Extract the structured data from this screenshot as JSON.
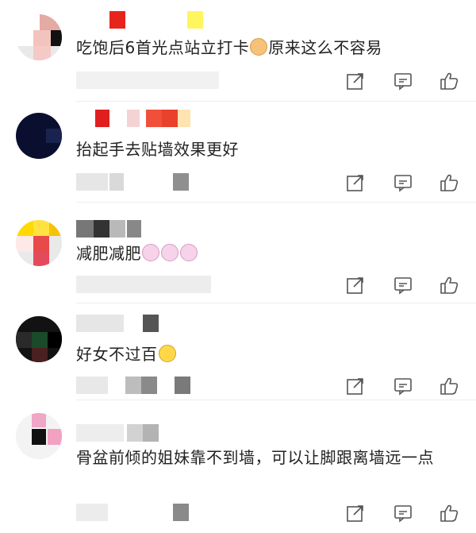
{
  "comments": [
    {
      "text": "吃饱后6首光点站立打卡",
      "text_after_emoji": "原来这么不容易",
      "emoji": "cat-face-emoji"
    },
    {
      "text": "抬起手去贴墙效果更好"
    },
    {
      "text": "减肥减肥",
      "emoji": "bunny-face-emoji"
    },
    {
      "text": "好女不过百",
      "emoji": "laughing-face-emoji"
    },
    {
      "text": "骨盆前倾的姐妹靠不到墙，可以让脚跟离墙远一点"
    }
  ],
  "icons": {
    "share": "share-icon",
    "reply": "reply-icon",
    "like": "like-icon"
  },
  "colors": {
    "text": "#222222",
    "icon": "#555555",
    "divider": "#ececec"
  }
}
